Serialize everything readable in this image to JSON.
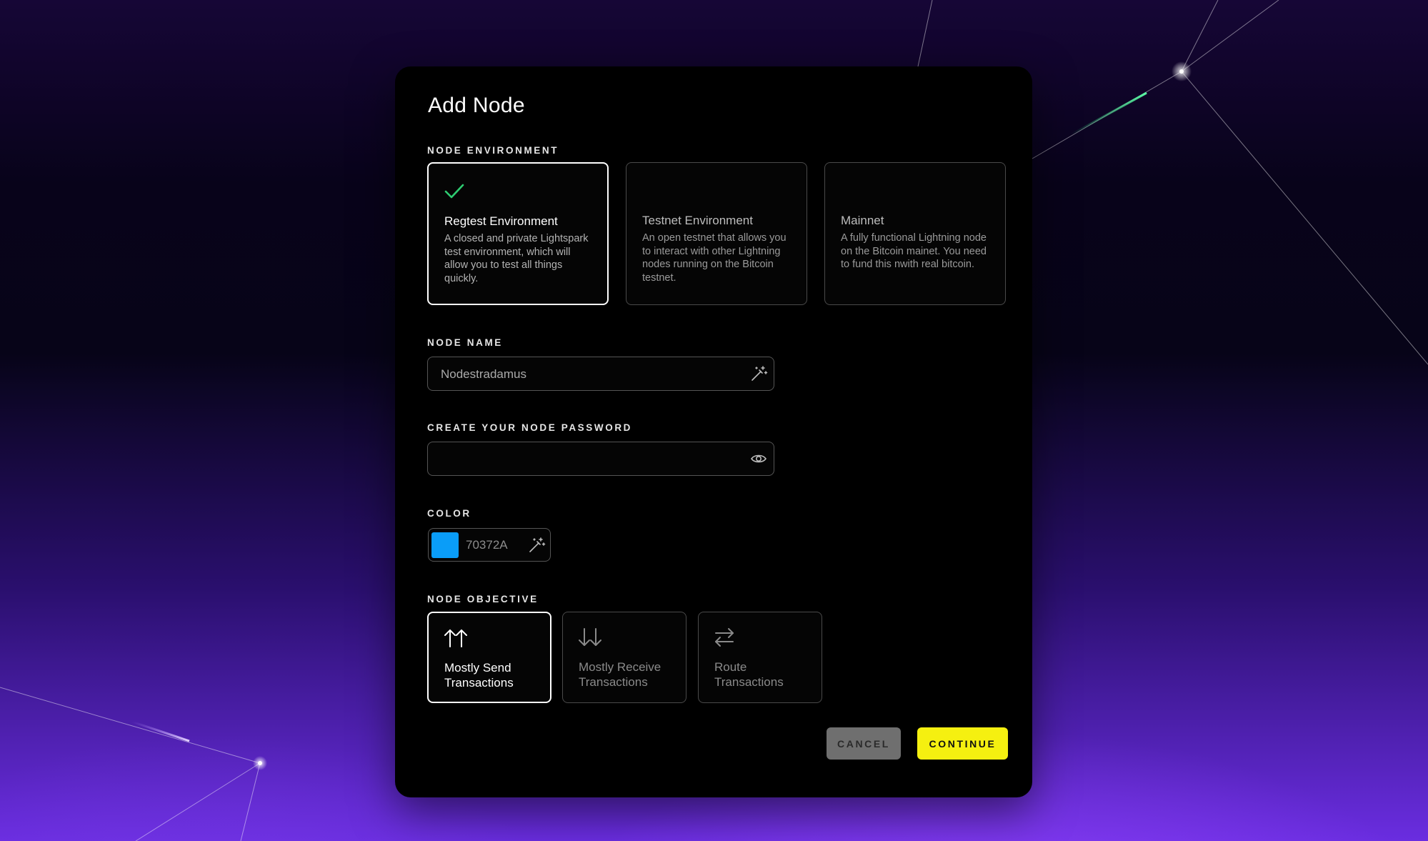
{
  "modal": {
    "title": "Add Node",
    "environment": {
      "label": "NODE ENVIRONMENT",
      "options": [
        {
          "name": "Regtest Environment",
          "description": "A closed and private Lightspark test environment, which will allow you to test all things quickly.",
          "selected": true
        },
        {
          "name": "Testnet Environment",
          "description": "An open testnet that allows you to interact with other Lightning nodes running on the Bitcoin testnet.",
          "selected": false
        },
        {
          "name": "Mainnet",
          "description": "A fully functional Lightning node on the Bitcoin mainet. You need to fund this nwith real bitcoin.",
          "selected": false
        }
      ]
    },
    "node_name": {
      "label": "NODE NAME",
      "value": "Nodestradamus",
      "icon": "magic-wand-icon"
    },
    "password": {
      "label": "CREATE YOUR NODE PASSWORD",
      "value": "",
      "icon": "eye-icon"
    },
    "color": {
      "label": "COLOR",
      "hex": "70372A",
      "swatch": "#0a9df8",
      "icon": "magic-wand-icon"
    },
    "objective": {
      "label": "NODE OBJECTIVE",
      "options": [
        {
          "label": "Mostly Send Transactions",
          "icon": "double-arrow-up-icon",
          "selected": true
        },
        {
          "label": "Mostly Receive Transactions",
          "icon": "double-arrow-down-icon",
          "selected": false
        },
        {
          "label": "Route Transactions",
          "icon": "swap-arrows-icon",
          "selected": false
        }
      ]
    },
    "buttons": {
      "cancel": "CANCEL",
      "continue": "CONTINUE"
    }
  },
  "colors": {
    "check": "#2ecc71",
    "continue_bg": "#f5f010",
    "cancel_bg": "#6f6f6f"
  }
}
